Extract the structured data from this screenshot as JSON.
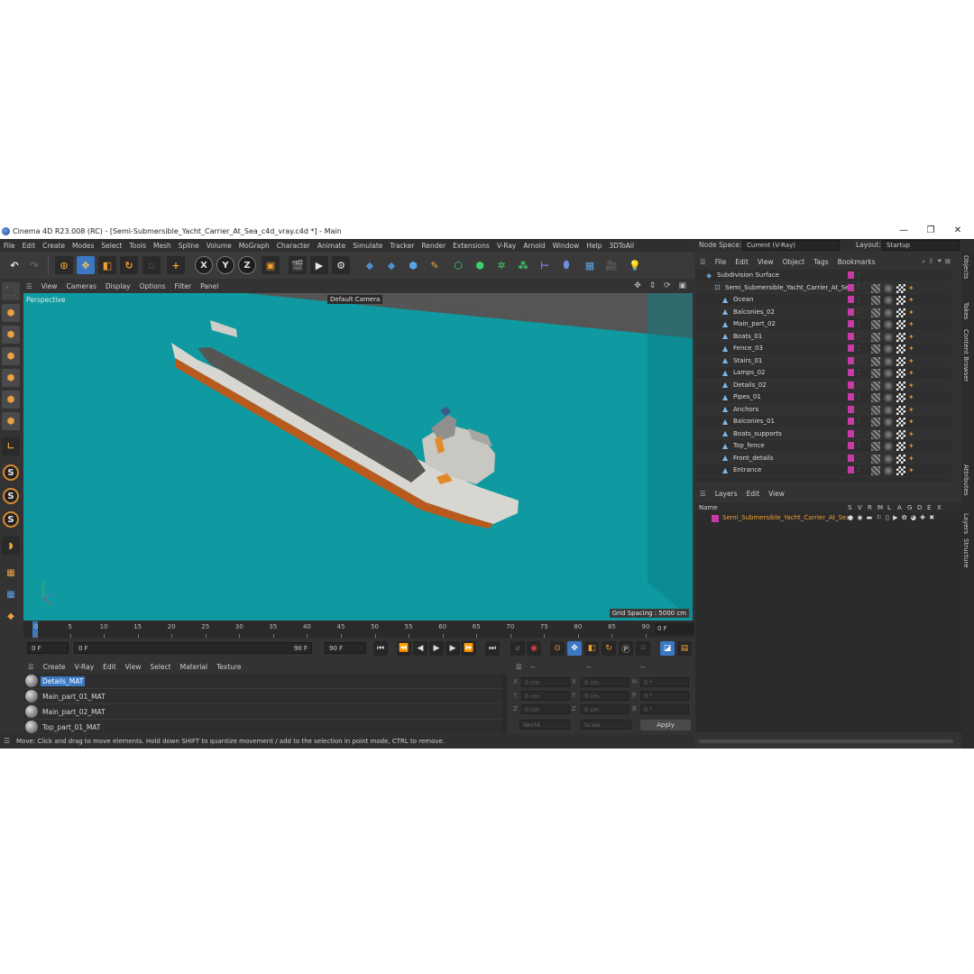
{
  "window": {
    "title": "Cinema 4D R23.008 (RC) - [Semi-Submersible_Yacht_Carrier_At_Sea_c4d_vray.c4d *] - Main",
    "controls": [
      "—",
      "❐",
      "✕"
    ]
  },
  "menubar": [
    "File",
    "Edit",
    "Create",
    "Modes",
    "Select",
    "Tools",
    "Mesh",
    "Spline",
    "Volume",
    "MoGraph",
    "Character",
    "Animate",
    "Simulate",
    "Tracker",
    "Render",
    "Extensions",
    "V-Ray",
    "Arnold",
    "Window",
    "Help",
    "3DToAll"
  ],
  "node_space": {
    "label": "Node Space:",
    "value": "Current (V-Ray)"
  },
  "layout": {
    "label": "Layout:",
    "value": "Startup"
  },
  "toolbar": {
    "axes": [
      "X",
      "Y",
      "Z"
    ]
  },
  "viewport": {
    "menu": [
      "View",
      "Cameras",
      "Display",
      "Options",
      "Filter",
      "Panel"
    ],
    "label": "Perspective",
    "camera": "Default Camera",
    "grid_spacing": "Grid Spacing : 5000 cm",
    "colors": {
      "sea": "#0e9aa0",
      "background": "#555555"
    }
  },
  "timeline": {
    "ticks": [
      "0",
      "5",
      "10",
      "15",
      "20",
      "25",
      "30",
      "35",
      "40",
      "45",
      "50",
      "55",
      "60",
      "65",
      "70",
      "75",
      "80",
      "85",
      "90"
    ],
    "current_frame": "0 F"
  },
  "transport": {
    "start": "0 F",
    "range_start": "0 F",
    "range_end": "90 F",
    "end": "90 F"
  },
  "material_manager": {
    "menu": [
      "Create",
      "V-Ray",
      "Edit",
      "View",
      "Select",
      "Material",
      "Texture"
    ],
    "materials": [
      "Details_MAT",
      "Main_part_01_MAT",
      "Main_part_02_MAT",
      "Top_part_01_MAT"
    ]
  },
  "coordinates": {
    "head": [
      "--",
      "--",
      "--"
    ],
    "rows": [
      {
        "a": "X",
        "av": "0 cm",
        "b": "X",
        "bv": "0 cm",
        "c": "H",
        "cv": "0 °"
      },
      {
        "a": "Y",
        "av": "0 cm",
        "b": "Y",
        "bv": "0 cm",
        "c": "P",
        "cv": "0 °"
      },
      {
        "a": "Z",
        "av": "0 cm",
        "b": "Z",
        "bv": "0 cm",
        "c": "B",
        "cv": "0 °"
      }
    ],
    "space": "World",
    "mode": "Scale",
    "apply": "Apply"
  },
  "status": "Move: Click and drag to move elements. Hold down SHIFT to quantize movement / add to the selection in point mode, CTRL to remove.",
  "object_manager": {
    "menu": [
      "File",
      "Edit",
      "View",
      "Object",
      "Tags",
      "Bookmarks"
    ],
    "objects": [
      {
        "name": "Subdivision Surface",
        "level": 0
      },
      {
        "name": "Semi_Submersible_Yacht_Carrier_At_Sea",
        "level": 1
      },
      {
        "name": "Ocean",
        "level": 2
      },
      {
        "name": "Balconies_02",
        "level": 2
      },
      {
        "name": "Main_part_02",
        "level": 2
      },
      {
        "name": "Boats_01",
        "level": 2
      },
      {
        "name": "Fence_03",
        "level": 2
      },
      {
        "name": "Stairs_01",
        "level": 2
      },
      {
        "name": "Lamps_02",
        "level": 2
      },
      {
        "name": "Details_02",
        "level": 2
      },
      {
        "name": "Pipes_01",
        "level": 2
      },
      {
        "name": "Anchors",
        "level": 2
      },
      {
        "name": "Balconies_01",
        "level": 2
      },
      {
        "name": "Boats_supports",
        "level": 2
      },
      {
        "name": "Top_fence",
        "level": 2
      },
      {
        "name": "Front_details",
        "level": 2
      },
      {
        "name": "Entrance",
        "level": 2
      }
    ]
  },
  "layer_manager": {
    "menu": [
      "Layers",
      "Edit",
      "View"
    ],
    "name_header": "Name",
    "flags": [
      "S",
      "V",
      "R",
      "M",
      "L",
      "A",
      "G",
      "D",
      "E",
      "X"
    ],
    "layers": [
      "Semi_Submersible_Yacht_Carrier_At_Sea"
    ]
  },
  "side_tabs": [
    "Objects",
    "Takes",
    "Content Browser",
    "Attributes",
    "Layers",
    "Structure"
  ]
}
